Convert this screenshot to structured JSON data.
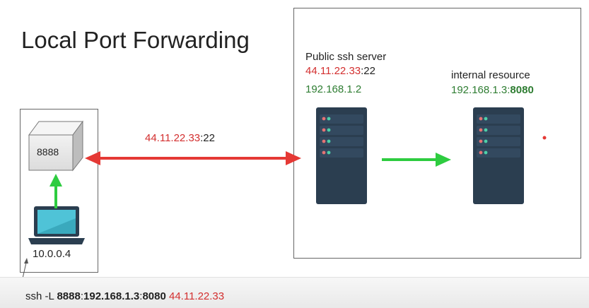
{
  "title": "Local Port Forwarding",
  "client": {
    "port_box_label": "8888",
    "ip": "10.0.0.4"
  },
  "tunnel": {
    "host": "44.11.22.33",
    "port": ":22"
  },
  "ssh_server": {
    "name": "Public ssh server",
    "public_host": "44.11.22.33",
    "public_port": ":22",
    "private_ip": "192.168.1.2"
  },
  "internal": {
    "name": "internal resource",
    "host": "192.168.1.3",
    "port_sep": ":",
    "port": "8080"
  },
  "command": {
    "prefix": "ssh -L ",
    "local_port": "8888",
    "sep1": ":",
    "target_host": "192.168.1.3",
    "sep2": ":",
    "target_port": "8080",
    "space": " ",
    "server": "44.11.22.33"
  },
  "colors": {
    "red": "#d32f2f",
    "green": "#2e7d32",
    "arrow_red": "#e53935",
    "arrow_green": "#2ecc40",
    "server_body": "#2b3e50"
  }
}
